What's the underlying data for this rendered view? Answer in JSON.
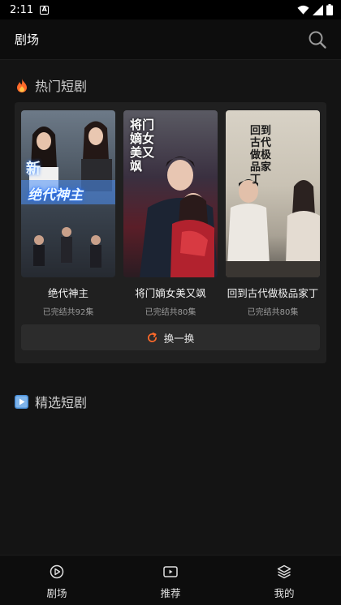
{
  "status_bar": {
    "time": "2:11",
    "notification_glyph": "A"
  },
  "app_bar": {
    "title": "剧场"
  },
  "hot_section": {
    "title": "热门短剧",
    "dramas": [
      {
        "name": "绝代神主",
        "meta": "已完结共92集",
        "poster_text": "绝代神主",
        "poster_tag": "新"
      },
      {
        "name": "将门嫡女美又飒",
        "meta": "已完结共80集",
        "poster_text": "将门嫡女美又飒"
      },
      {
        "name": "回到古代做极品家丁",
        "meta": "已完结共80集",
        "poster_text": "回到古代做极品家丁"
      }
    ],
    "refresh_label": "换一换"
  },
  "featured_section": {
    "title": "精选短剧"
  },
  "tabs": [
    {
      "label": "剧场",
      "icon": "play-circle-icon"
    },
    {
      "label": "推荐",
      "icon": "video-icon"
    },
    {
      "label": "我的",
      "icon": "layers-icon"
    }
  ],
  "colors": {
    "background": "#141414",
    "card": "#202020",
    "accent_fire": "#ff6a2a",
    "accent_play": "#4a8fd8"
  }
}
